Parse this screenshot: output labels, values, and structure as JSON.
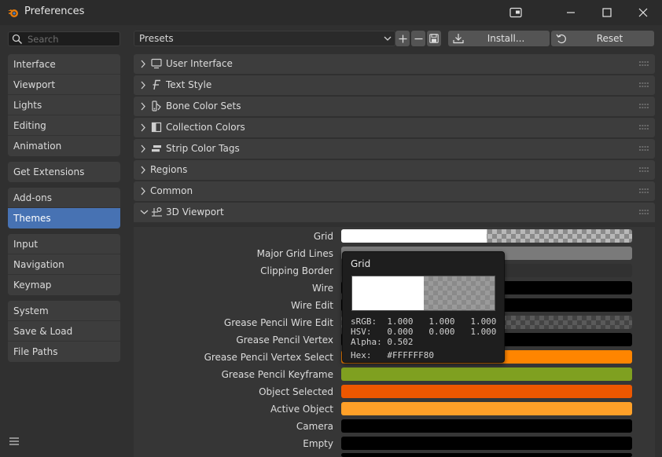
{
  "window": {
    "title": "Preferences",
    "icon": "blender-logo-icon"
  },
  "sidebar": {
    "search_placeholder": "Search",
    "groups": [
      [
        "Interface",
        "Viewport",
        "Lights",
        "Editing",
        "Animation"
      ],
      [
        "Get Extensions"
      ],
      [
        "Add-ons",
        "Themes"
      ],
      [
        "Input",
        "Navigation",
        "Keymap"
      ],
      [
        "System",
        "Save & Load",
        "File Paths"
      ]
    ],
    "active_item": "Themes"
  },
  "toolbar": {
    "presets_label": "Presets",
    "install_label": "Install...",
    "reset_label": "Reset"
  },
  "panels": [
    {
      "label": "User Interface",
      "icon": "monitor-icon",
      "expanded": false
    },
    {
      "label": "Text Style",
      "icon": "font-icon",
      "expanded": false
    },
    {
      "label": "Bone Color Sets",
      "icon": "bone-color-icon",
      "expanded": false
    },
    {
      "label": "Collection Colors",
      "icon": "collection-icon",
      "expanded": false
    },
    {
      "label": "Strip Color Tags",
      "icon": "strip-icon",
      "expanded": false
    },
    {
      "label": "Regions",
      "icon": "",
      "expanded": false
    },
    {
      "label": "Common",
      "icon": "",
      "expanded": false
    },
    {
      "label": "3D Viewport",
      "icon": "viewport-3d-icon",
      "expanded": true
    }
  ],
  "viewport_props": [
    {
      "label": "Grid",
      "color": "#FFFFFF",
      "alpha": 0.502
    },
    {
      "label": "Major Grid Lines",
      "color": "#7A7A7A",
      "alpha": 1.0
    },
    {
      "label": "Clipping Border",
      "color": "#313131",
      "alpha": 1.0
    },
    {
      "label": "Wire",
      "color": "#000000",
      "alpha": 1.0
    },
    {
      "label": "Wire Edit",
      "color": "#000000",
      "alpha": 1.0
    },
    {
      "label": "Grease Pencil Wire Edit",
      "color": "#FFFFFF",
      "alpha": 0.3
    },
    {
      "label": "Grease Pencil Vertex",
      "color": "#000000",
      "alpha": 1.0
    },
    {
      "label": "Grease Pencil Vertex Select",
      "color": "#FF8500",
      "alpha": 1.0
    },
    {
      "label": "Grease Pencil Keyframe",
      "color": "#7FA020",
      "alpha": 1.0
    },
    {
      "label": "Object Selected",
      "color": "#ED5700",
      "alpha": 1.0
    },
    {
      "label": "Active Object",
      "color": "#FFA028",
      "alpha": 1.0
    },
    {
      "label": "Camera",
      "color": "#000000",
      "alpha": 1.0
    },
    {
      "label": "Empty",
      "color": "#000000",
      "alpha": 1.0
    }
  ],
  "tooltip": {
    "title": "Grid",
    "srgb_line": "sRGB:  1.000   1.000   1.000",
    "hsv_line": "HSV:   0.000   0.000   1.000",
    "alpha_line": "Alpha: 0.502",
    "hex_line": "Hex:   #FFFFFF80"
  }
}
